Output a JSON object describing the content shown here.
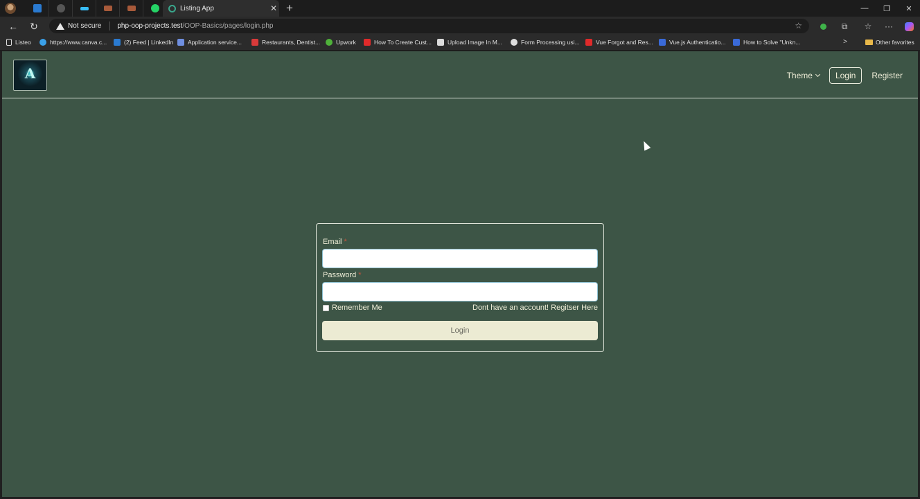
{
  "browser": {
    "active_tab_title": "Listing App",
    "tab_close": "✕",
    "new_tab": "+",
    "security_label": "Not secure",
    "url_host": "php-oop-projects.test",
    "url_path": "/OOP-Basics/pages/login.php",
    "window_controls": {
      "minimize": "—",
      "restore": "❐",
      "close": "✕"
    },
    "nav": {
      "back": "←",
      "reload": "↻"
    },
    "toolbar_icons": [
      "extension-icon",
      "puzzle-icon",
      "favorites-icon",
      "more-icon",
      "copilot-icon"
    ],
    "more": "···",
    "bookmarks": [
      {
        "label": "Listeo",
        "color": "#dddddd"
      },
      {
        "label": "https://www.canva.c...",
        "color": "#3aa0e8"
      },
      {
        "label": "(2) Feed | LinkedIn",
        "color": "#2a7ad0"
      },
      {
        "label": "Application service...",
        "color": "#6f8fe0"
      },
      {
        "label": "Restaurants, Dentist...",
        "color": "#d83a3a"
      },
      {
        "label": "Upwork",
        "color": "#4fb13a"
      },
      {
        "label": "How To Create Cust...",
        "color": "#e02a2a"
      },
      {
        "label": "Upload Image In M...",
        "color": "#dddddd"
      },
      {
        "label": "Form Processing usi...",
        "color": "#dddddd"
      },
      {
        "label": "Vue Forgot and Res...",
        "color": "#e02a2a"
      },
      {
        "label": "Vue.js Authenticatio...",
        "color": "#3a6ad8"
      },
      {
        "label": "How to Solve \"Unkn...",
        "color": "#3a6ad8"
      }
    ],
    "bookmarks_more": ">",
    "other_favorites": "Other favorites"
  },
  "navbar": {
    "theme_label": "Theme",
    "login_label": "Login",
    "register_label": "Register",
    "logo_letter": "A"
  },
  "form": {
    "email_label": "Email",
    "password_label": "Password",
    "required_mark": "*",
    "email_value": "",
    "password_value": "",
    "remember_label": "Remember Me",
    "register_link": "Dont have an account! Regitser Here",
    "submit_label": "Login"
  },
  "colors": {
    "page_bg": "#3d5546",
    "text": "#f1efd9",
    "button_bg": "#ecebd3",
    "required": "#c4553f"
  }
}
